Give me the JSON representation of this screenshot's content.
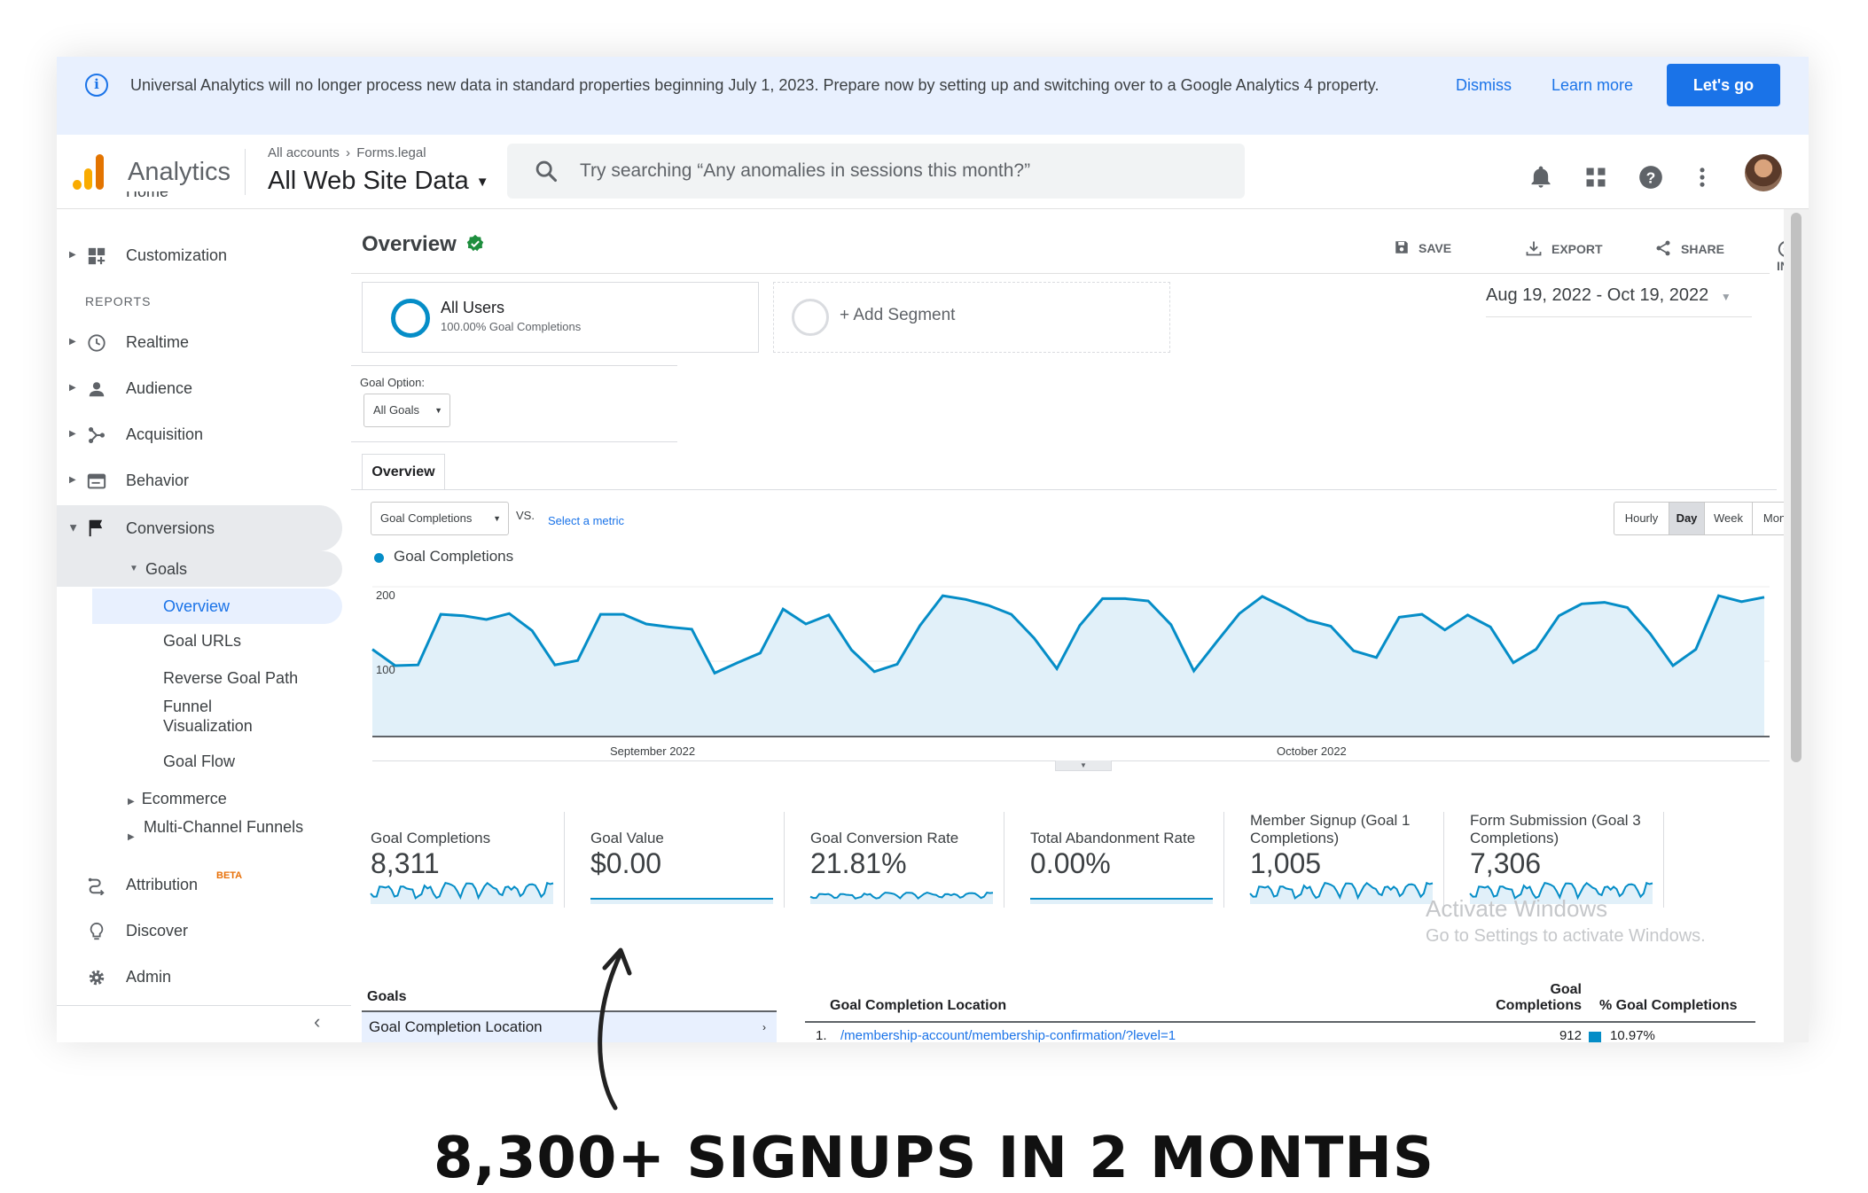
{
  "banner": {
    "message": "Universal Analytics will no longer process new data in standard properties beginning July 1, 2023. Prepare now by setting up and switching over to a Google Analytics 4 property.",
    "dismiss": "Dismiss",
    "learn_more": "Learn more",
    "lets_go": "Let's go"
  },
  "topbar": {
    "app_name": "Analytics",
    "crumb_accounts": "All accounts",
    "crumb_property": "Forms.legal",
    "view_name": "All Web Site Data",
    "search_placeholder": "Try searching “Any anomalies in sessions this month?”"
  },
  "sidebar": {
    "home": "Home",
    "customization": "Customization",
    "reports_label": "REPORTS",
    "realtime": "Realtime",
    "audience": "Audience",
    "acquisition": "Acquisition",
    "behavior": "Behavior",
    "conversions": "Conversions",
    "goals": "Goals",
    "goals_items": [
      "Overview",
      "Goal URLs",
      "Reverse Goal Path",
      "Funnel Visualization",
      "Goal Flow"
    ],
    "ecommerce": "Ecommerce",
    "multichannel": "Multi-Channel Funnels",
    "attribution": "Attribution",
    "attribution_badge": "BETA",
    "discover": "Discover",
    "admin": "Admin"
  },
  "header": {
    "title": "Overview",
    "save": "SAVE",
    "export": "EXPORT",
    "share": "SHARE",
    "insights": "INSIGHTS"
  },
  "segments": {
    "all_users": "All Users",
    "all_users_sub": "100.00% Goal Completions",
    "add_segment": "+ Add Segment"
  },
  "date_range": "Aug 19, 2022 - Oct 19, 2022",
  "goal_option": {
    "label": "Goal Option:",
    "value": "All Goals"
  },
  "tab_overview": "Overview",
  "metric_select": "Goal Completions",
  "vs": "VS.",
  "select_metric": "Select a metric",
  "time_buttons": [
    "Hourly",
    "Day",
    "Week",
    "Month"
  ],
  "active_time": "Day",
  "chart_data": {
    "type": "area",
    "series": [
      {
        "name": "Goal Completions",
        "values": [
          116,
          94,
          95,
          163,
          161,
          156,
          164,
          141,
          95,
          101,
          163,
          163,
          150,
          146,
          143,
          84,
          98,
          111,
          170,
          150,
          162,
          115,
          86,
          96,
          148,
          188,
          183,
          175,
          163,
          131,
          90,
          148,
          184,
          184,
          181,
          149,
          87,
          126,
          164,
          187,
          172,
          155,
          147,
          114,
          105,
          159,
          163,
          142,
          162,
          146,
          98,
          116,
          161,
          177,
          179,
          172,
          137,
          94,
          116,
          188,
          180,
          186
        ]
      }
    ],
    "x_labels": [
      "September 2022",
      "October 2022"
    ],
    "y_ticks": [
      100,
      200
    ],
    "ylim": [
      0,
      200
    ]
  },
  "metrics": [
    {
      "label": "Goal Completions",
      "value": "8,311"
    },
    {
      "label": "Goal Value",
      "value": "$0.00"
    },
    {
      "label": "Goal Conversion Rate",
      "value": "21.81%"
    },
    {
      "label": "Total Abandonment Rate",
      "value": "0.00%"
    },
    {
      "label": "Member Signup (Goal 1 Completions)",
      "value": "1,005"
    },
    {
      "label": "Form Submission (Goal 3 Completions)",
      "value": "7,306"
    }
  ],
  "watermark": {
    "line1": "Activate Windows",
    "line2": "Go to Settings to activate Windows."
  },
  "goals_table": {
    "left_header": "Goals",
    "left_item": "Goal Completion Location",
    "col_location": "Goal Completion Location",
    "col_completions": "Goal Completions",
    "col_pct": "% Goal Completions",
    "row1_index": "1.",
    "row1_path": "/membership-account/membership-confirmation/?level=1",
    "row1_value": "912",
    "row1_pct": "10.97%"
  },
  "caption": "8,300+ SIGNUPS IN 2 MONTHS",
  "colors": {
    "accent": "#1a73e8",
    "chart_line": "#058dc7",
    "chart_fill": "#e1f0f9"
  }
}
